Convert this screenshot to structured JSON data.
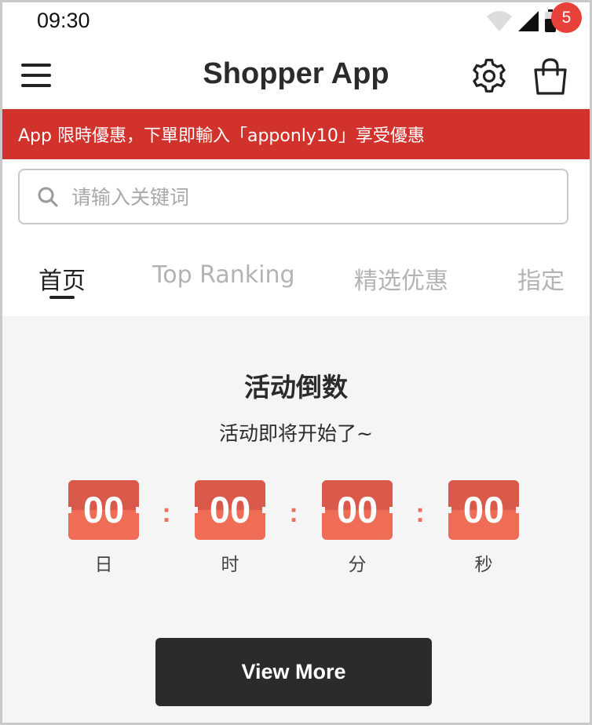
{
  "status_bar": {
    "time": "09:30",
    "icons": [
      "wifi-icon",
      "cellular-signal-icon",
      "battery-icon"
    ]
  },
  "header": {
    "title": "Shopper App",
    "menu_icon": "hamburger-menu-icon",
    "settings_icon": "gear-icon",
    "cart_icon": "shopping-bag-icon",
    "cart_count": "5"
  },
  "promo": {
    "text": "App 限時優惠，下單即輸入「apponly10」享受優惠",
    "background": "#d1322c"
  },
  "search": {
    "placeholder": "请输入关键词",
    "value": ""
  },
  "tabs": [
    {
      "label": "首页",
      "active": true
    },
    {
      "label": "Top Ranking",
      "active": false
    },
    {
      "label": "精选优惠",
      "active": false
    },
    {
      "label": "指定",
      "active": false
    }
  ],
  "countdown": {
    "title": "活动倒数",
    "subtitle": "活动即将开始了~",
    "separator": ":",
    "units": [
      {
        "value": "00",
        "label": "日"
      },
      {
        "value": "00",
        "label": "时"
      },
      {
        "value": "00",
        "label": "分"
      },
      {
        "value": "00",
        "label": "秒"
      }
    ],
    "accent": "#ef6d56"
  },
  "view_more_label": "View More"
}
